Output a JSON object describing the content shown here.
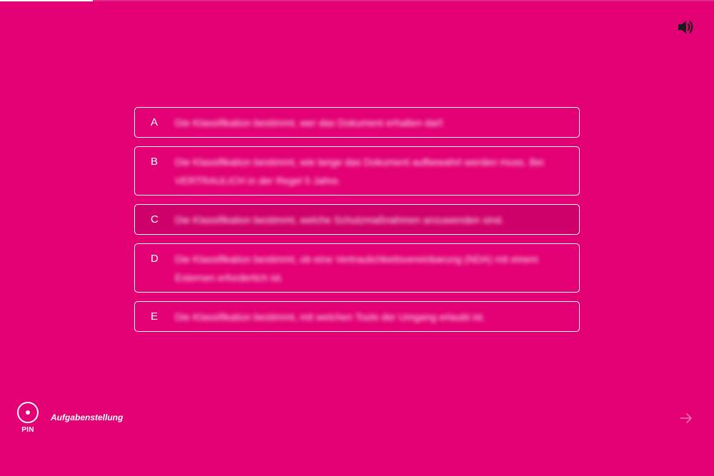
{
  "progress": {
    "fraction": 0.13
  },
  "header": {
    "sound_icon": "speaker-volume-icon"
  },
  "options": [
    {
      "letter": "A",
      "text": "Die Klassifikation bestimmt, wer das Dokument erhalten darf."
    },
    {
      "letter": "B",
      "text": "Die Klassifikation bestimmt, wie lange das Dokument aufbewahrt werden muss. Bei VERTRAULICH in der Regel 5 Jahre."
    },
    {
      "letter": "C",
      "text": "Die Klassifikation bestimmt, welche Schutzmaßnahmen anzuwenden sind."
    },
    {
      "letter": "D",
      "text": "Die Klassifikation bestimmt, ob eine Vertraulichkeitsvereinbarung (NDA) mit einem Externen erforderlich ist."
    },
    {
      "letter": "E",
      "text": "Die Klassifikation bestimmt, mit welchen Tools der Umgang erlaubt ist."
    }
  ],
  "footer": {
    "pin_label": "PIN",
    "task_label": "Aufgabenstellung",
    "next_icon": "arrow-right-icon"
  },
  "colors": {
    "background": "#e20074",
    "highlight": "#cf0069",
    "foreground": "#ffffff"
  }
}
